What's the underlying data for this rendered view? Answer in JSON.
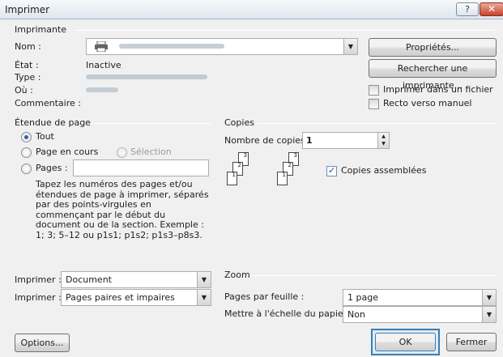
{
  "window": {
    "title": "Imprimer",
    "help": "?",
    "close": "✕"
  },
  "printer": {
    "section": "Imprimante",
    "name_label": "Nom :",
    "status_label": "État :",
    "status_value": "Inactive",
    "type_label": "Type :",
    "where_label": "Où :",
    "comment_label": "Commentaire :",
    "properties_button": "Propriétés...",
    "find_button": "Rechercher une imprimante...",
    "print_to_file": "Imprimer dans un fichier",
    "manual_duplex": "Recto verso manuel"
  },
  "range": {
    "section": "Étendue de page",
    "all": "Tout",
    "current": "Page en cours",
    "selection": "Sélection",
    "pages": "Pages :",
    "help_text": "Tapez les numéros des pages et/ou étendues de page à imprimer, séparés par des points-virgules en commençant par le début du document ou de la section. Exemple : 1; 3; 5–12 ou p1s1; p1s2; p1s3–p8s3."
  },
  "copies": {
    "section": "Copies",
    "count_label": "Nombre de copies :",
    "count_value": "1",
    "collate": "Copies assemblées",
    "page_numbers": [
      "3",
      "2",
      "1"
    ]
  },
  "print_what": {
    "label": "Imprimer :",
    "value": "Document"
  },
  "print_pages": {
    "label": "Imprimer :",
    "value": "Pages paires et impaires"
  },
  "zoom": {
    "section": "Zoom",
    "per_sheet_label": "Pages par feuille :",
    "per_sheet_value": "1 page",
    "scale_label": "Mettre à l'échelle du papier :",
    "scale_value": "Non"
  },
  "footer": {
    "options": "Options...",
    "ok": "OK",
    "close": "Fermer"
  },
  "colors": {
    "accent": "#3c7fb1",
    "titlebar": "#dfe6ef",
    "close": "#c7432b"
  }
}
